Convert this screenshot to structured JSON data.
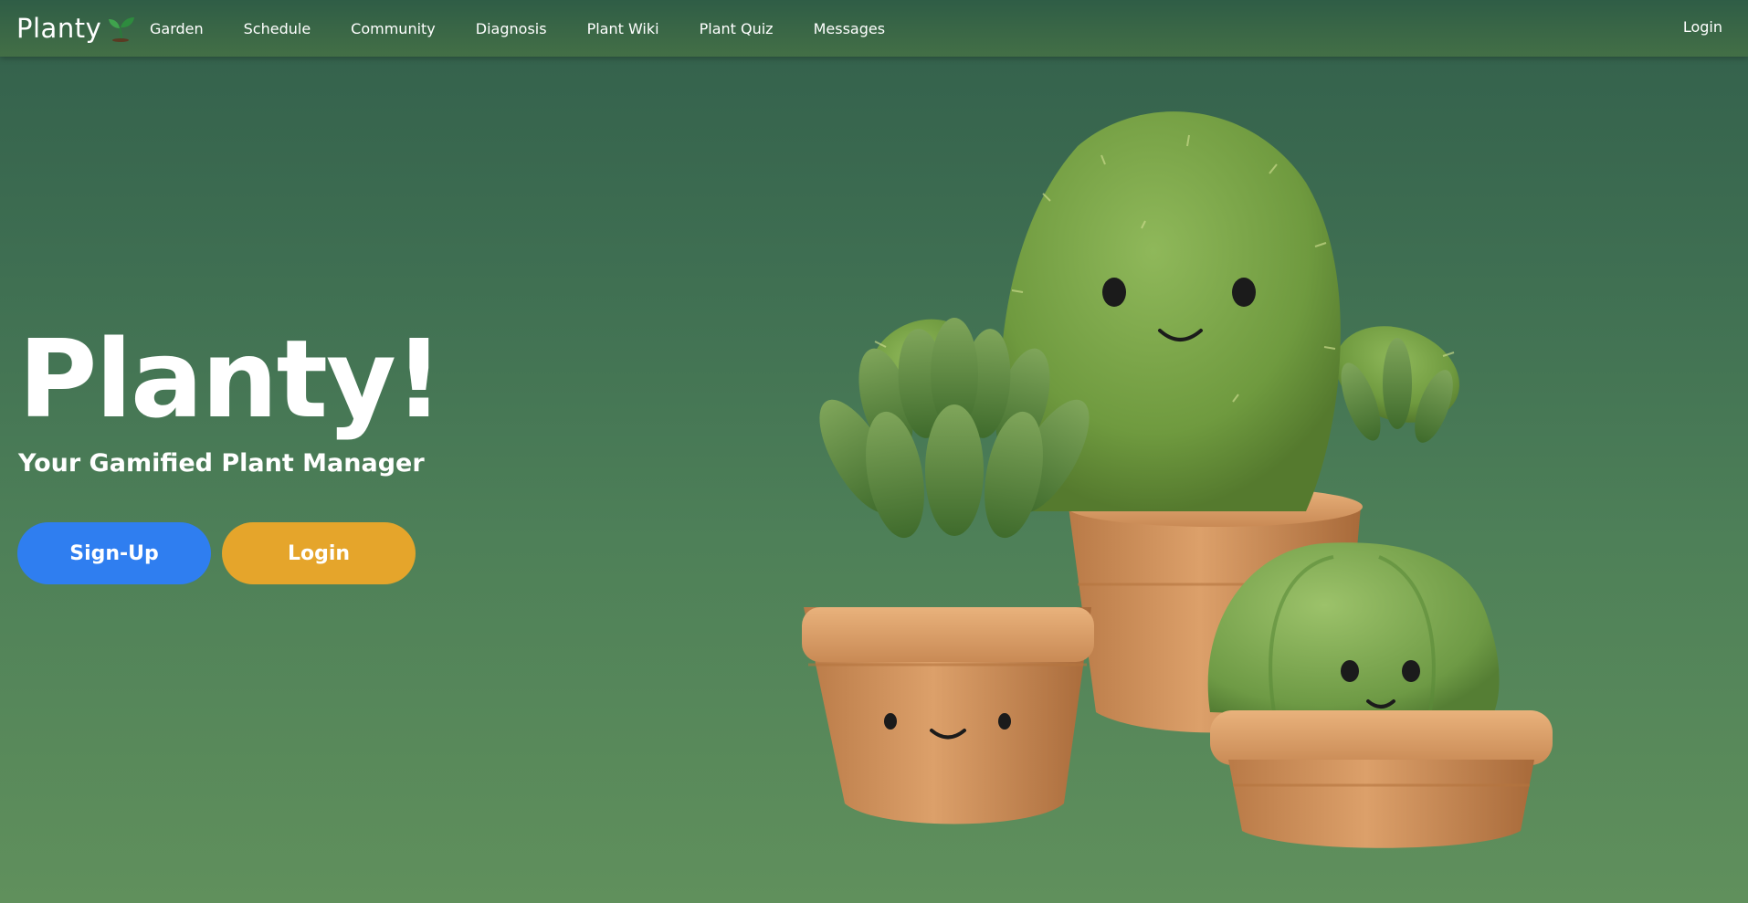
{
  "brand": {
    "name": "Planty",
    "icon": "sprout-icon"
  },
  "nav": {
    "links": [
      "Garden",
      "Schedule",
      "Community",
      "Diagnosis",
      "Plant Wiki",
      "Plant Quiz",
      "Messages"
    ],
    "login": "Login"
  },
  "hero": {
    "title": "Planty!",
    "subtitle": "Your Gamified Plant Manager",
    "signup_label": "Sign-Up",
    "login_label": "Login"
  },
  "colors": {
    "signup_button": "#2f7ef0",
    "login_button": "#e5a52b",
    "nav_background": "#3a6647",
    "page_background": "#4e8058"
  },
  "illustration": {
    "icon": "cactus-family-illustration"
  }
}
